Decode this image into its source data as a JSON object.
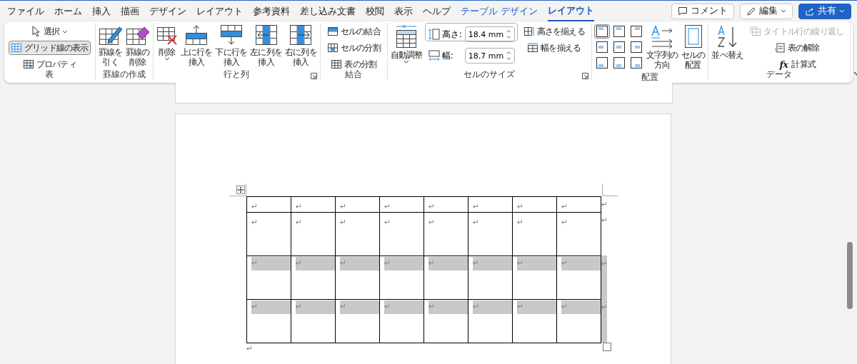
{
  "menu_tabs": [
    {
      "label": "ファイル",
      "kind": "normal",
      "selected": false
    },
    {
      "label": "ホーム",
      "kind": "normal",
      "selected": false
    },
    {
      "label": "挿入",
      "kind": "normal",
      "selected": false
    },
    {
      "label": "描画",
      "kind": "normal",
      "selected": false
    },
    {
      "label": "デザイン",
      "kind": "normal",
      "selected": false
    },
    {
      "label": "レイアウト",
      "kind": "normal",
      "selected": false
    },
    {
      "label": "参考資料",
      "kind": "normal",
      "selected": false
    },
    {
      "label": "差し込み文書",
      "kind": "normal",
      "selected": false
    },
    {
      "label": "校閲",
      "kind": "normal",
      "selected": false
    },
    {
      "label": "表示",
      "kind": "normal",
      "selected": false
    },
    {
      "label": "ヘルプ",
      "kind": "normal",
      "selected": false
    },
    {
      "label": "テーブル デザイン",
      "kind": "context",
      "selected": false
    },
    {
      "label": "レイアウト",
      "kind": "context",
      "selected": true
    }
  ],
  "header_buttons": [
    {
      "label": "コメント",
      "kind": "comment"
    },
    {
      "label": "編集",
      "kind": "edit"
    },
    {
      "label": "共有",
      "kind": "share"
    }
  ],
  "ribbon_groups": [
    {
      "label": "表",
      "launcher": false,
      "items": [
        {
          "kind": "small",
          "label": "選択",
          "dropdown": true,
          "on": false,
          "disabled": false
        },
        {
          "kind": "small",
          "label": "グリッド線の表示",
          "dropdown": false,
          "on": true,
          "disabled": false
        },
        {
          "kind": "small",
          "label": "プロパティ",
          "dropdown": false,
          "on": false,
          "disabled": false
        }
      ]
    },
    {
      "label": "罫線の作成",
      "launcher": false,
      "items": [
        {
          "kind": "large",
          "label_lines": [
            "罫線を",
            "引く"
          ],
          "dropdown": false
        },
        {
          "kind": "large",
          "label_lines": [
            "罫線の",
            "削除"
          ],
          "dropdown": false
        }
      ]
    },
    {
      "label": "行と列",
      "launcher": true,
      "items": [
        {
          "kind": "large",
          "label_lines": [
            "削除"
          ],
          "dropdown": true
        },
        {
          "kind": "large",
          "label_lines": [
            "上に行を",
            "挿入"
          ],
          "dropdown": false
        },
        {
          "kind": "large",
          "label_lines": [
            "下に行を",
            "挿入"
          ],
          "dropdown": false
        },
        {
          "kind": "large",
          "label_lines": [
            "左に列を",
            "挿入"
          ],
          "dropdown": false
        },
        {
          "kind": "large",
          "label_lines": [
            "右に列を",
            "挿入"
          ],
          "dropdown": false
        }
      ]
    },
    {
      "label": "結合",
      "launcher": false,
      "items": [
        {
          "kind": "small",
          "label": "セルの結合",
          "dropdown": false,
          "on": false,
          "disabled": false
        },
        {
          "kind": "small",
          "label": "セルの分割",
          "dropdown": false,
          "on": false,
          "disabled": false
        },
        {
          "kind": "small",
          "label": "表の分割",
          "dropdown": false,
          "on": false,
          "disabled": false
        }
      ]
    },
    {
      "label": "セルのサイズ",
      "launcher": true,
      "items": [
        {
          "kind": "large",
          "label_lines": [
            "自動調整"
          ],
          "dropdown": true
        },
        {
          "kind": "field",
          "label": "高さ:",
          "value": "18.4 mm"
        },
        {
          "kind": "field",
          "label": "幅:",
          "value": "18.7 mm"
        },
        {
          "kind": "small",
          "label": "高さを揃える",
          "dropdown": false,
          "on": false,
          "disabled": false
        },
        {
          "kind": "small",
          "label": "幅を揃える",
          "dropdown": false,
          "on": false,
          "disabled": false
        }
      ]
    },
    {
      "label": "配置",
      "launcher": false,
      "items": [
        {
          "kind": "align-grid",
          "cells": [
            {
              "selected": true
            },
            {
              "selected": false
            },
            {
              "selected": false
            },
            {
              "selected": false
            },
            {
              "selected": false
            },
            {
              "selected": false
            },
            {
              "selected": false
            },
            {
              "selected": false
            },
            {
              "selected": false
            }
          ]
        },
        {
          "kind": "large",
          "label_lines": [
            "文字列の",
            "方向"
          ],
          "dropdown": false
        },
        {
          "kind": "large",
          "label_lines": [
            "セルの",
            "配置"
          ],
          "dropdown": false
        }
      ]
    },
    {
      "label": "データ",
      "launcher": false,
      "items": [
        {
          "kind": "large",
          "label_lines": [
            "並べ替え"
          ],
          "dropdown": false
        },
        {
          "kind": "small",
          "label": "タイトル行の繰り返し",
          "dropdown": false,
          "on": false,
          "disabled": true
        },
        {
          "kind": "small",
          "label": "表の解除",
          "dropdown": false,
          "on": false,
          "disabled": false
        },
        {
          "kind": "small",
          "label": "計算式",
          "icon_text": "fx",
          "dropdown": false,
          "on": false,
          "disabled": false
        }
      ]
    }
  ],
  "table": {
    "rows": [
      {
        "selected": false,
        "cells": [
          "↵",
          "↵",
          "↵",
          "↵",
          "↵",
          "↵",
          "↵",
          "↵"
        ],
        "end_mark": "↵"
      },
      {
        "selected": false,
        "cells": [
          "↵",
          "↵",
          "↵",
          "↵",
          "↵",
          "↵",
          "↵",
          "↵"
        ],
        "end_mark": "↵"
      },
      {
        "selected": true,
        "cells": [
          "↵",
          "↵",
          "↵",
          "↵",
          "↵",
          "↵",
          "↵",
          "↵"
        ],
        "end_mark": "↵"
      },
      {
        "selected": true,
        "cells": [
          "↵",
          "↵",
          "↵",
          "↵",
          "↵",
          "↵",
          "↵",
          "↵"
        ],
        "end_mark": "↵"
      }
    ]
  },
  "after_table_mark": "↵"
}
